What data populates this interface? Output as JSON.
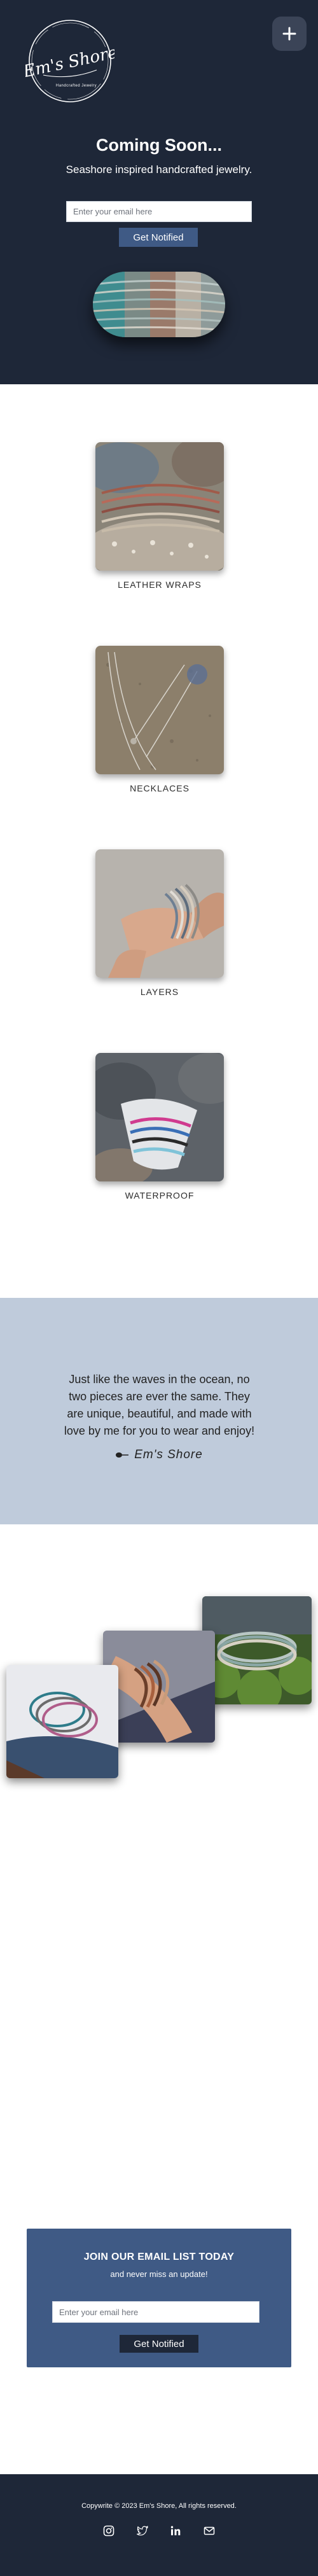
{
  "brand": {
    "name": "Em's Shore",
    "logo_subtext": "Handcrafted Jewelry"
  },
  "hero": {
    "heading": "Coming Soon...",
    "tagline": "Seashore inspired handcrafted jewelry.",
    "email_placeholder": "Enter your email here",
    "button_label": "Get Notified",
    "menu_icon": "plus-icon"
  },
  "products": [
    {
      "label": "LEATHER WRAPS"
    },
    {
      "label": "NECKLACES"
    },
    {
      "label": "LAYERS"
    },
    {
      "label": "WATERPROOF"
    }
  ],
  "quote": {
    "text": "Just like the waves in the ocean, no two pieces are ever the same. They are unique, beautiful, and made with love by me for you to wear and enjoy!",
    "signature": "Em's Shore"
  },
  "newsletter": {
    "title": "JOIN OUR EMAIL LIST TODAY",
    "subtitle": "and never miss an update!",
    "email_placeholder": "Enter your email here",
    "button_label": "Get Notified"
  },
  "footer": {
    "copyright": "Copywrite © 2023 Em's Shore, All rights reserved.",
    "social_icons": [
      "instagram-icon",
      "twitter-icon",
      "linkedin-icon",
      "mail-icon"
    ]
  },
  "colors": {
    "navy": "#1e2738",
    "accent_blue": "#3f5a85",
    "quote_band": "#bfcbdb",
    "menu_button": "#3b4457"
  }
}
